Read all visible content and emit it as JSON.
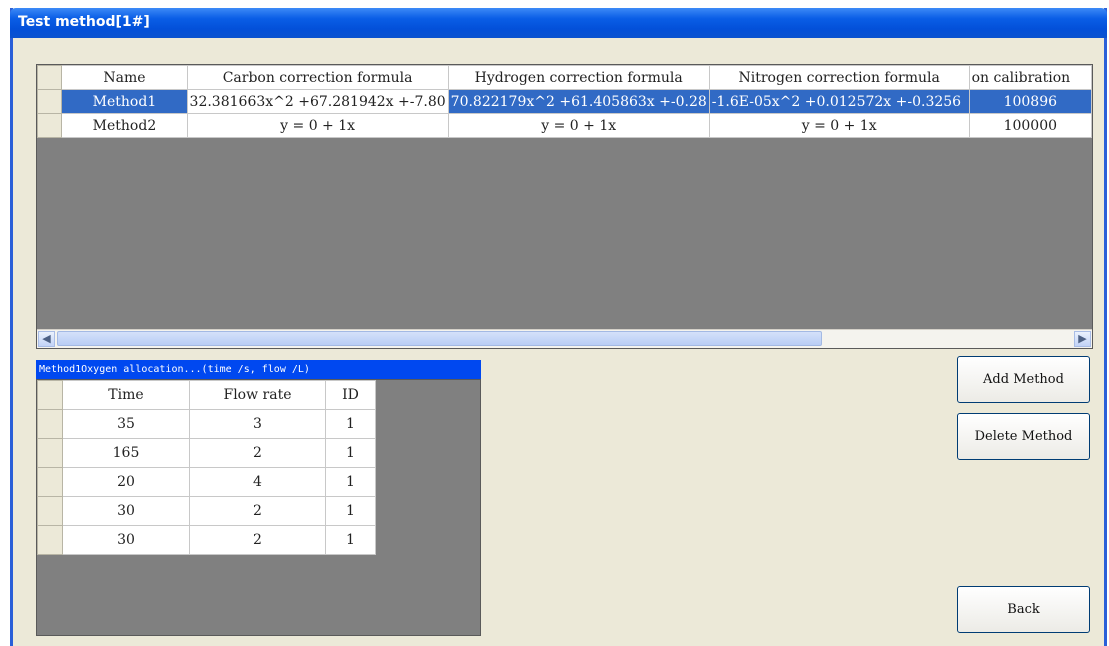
{
  "window": {
    "title": "Test method[1#]"
  },
  "methods_grid": {
    "columns": [
      "Name",
      "Carbon correction formula",
      "Hydrogen correction formula",
      "Nitrogen correction formula",
      "on calibration"
    ],
    "rows": [
      {
        "name": "Method1",
        "carbon": "32.381663x^2 +67.281942x +-7.80",
        "hydrogen": "70.822179x^2 +61.405863x +-0.28",
        "nitrogen": "-1.6E-05x^2 +0.012572x +-0.3256",
        "calibration": "100896",
        "selected": true
      },
      {
        "name": "Method2",
        "carbon": "y = 0 + 1x",
        "hydrogen": "y = 0 + 1x",
        "nitrogen": "y = 0 + 1x",
        "calibration": "100000",
        "selected": false
      }
    ],
    "scroll_left_icon": "arrow-left-icon",
    "scroll_right_icon": "arrow-right-icon"
  },
  "oxygen_panel": {
    "title": "Method1Oxygen allocation...(time /s, flow /L)",
    "columns": [
      "Time",
      "Flow rate",
      "ID"
    ],
    "rows": [
      {
        "time": "35",
        "flow": "3",
        "id": "1"
      },
      {
        "time": "165",
        "flow": "2",
        "id": "1"
      },
      {
        "time": "20",
        "flow": "4",
        "id": "1"
      },
      {
        "time": "30",
        "flow": "2",
        "id": "1"
      },
      {
        "time": "30",
        "flow": "2",
        "id": "1"
      }
    ]
  },
  "buttons": {
    "add": "Add Method",
    "delete": "Delete Method",
    "back": "Back"
  }
}
